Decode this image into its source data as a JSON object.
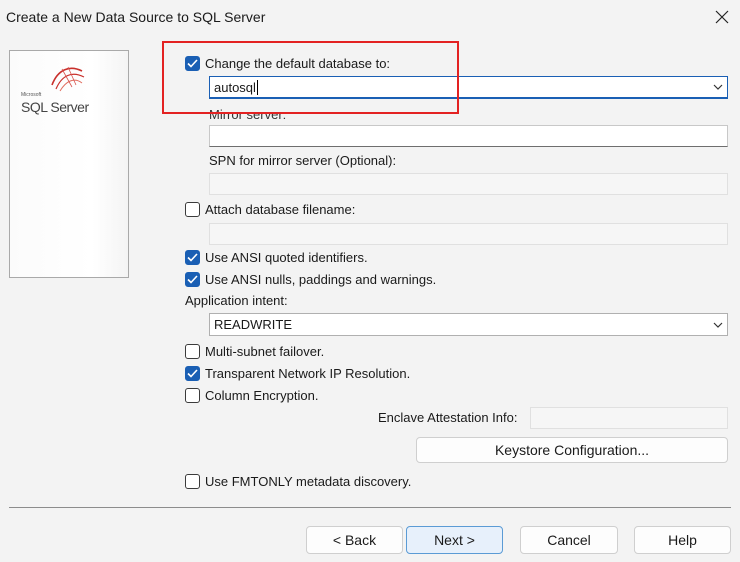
{
  "window": {
    "title": "Create a New Data Source to SQL Server"
  },
  "logo": {
    "small_text": "Microsoft",
    "text": "SQL Server"
  },
  "options": {
    "change_default_db": {
      "label": "Change the default database to:",
      "checked": true
    },
    "database_value": "autosql",
    "mirror_server_label": "Mirror server:",
    "spn_label": "SPN for mirror server (Optional):",
    "attach_db": {
      "label": "Attach database filename:",
      "checked": false
    },
    "ansi_quoted": {
      "label": "Use ANSI quoted identifiers.",
      "checked": true
    },
    "ansi_nulls": {
      "label": "Use ANSI nulls, paddings and warnings.",
      "checked": true
    },
    "app_intent_label": "Application intent:",
    "app_intent_value": "READWRITE",
    "multi_subnet": {
      "label": "Multi-subnet failover.",
      "checked": false
    },
    "transparent_ip": {
      "label": "Transparent Network IP Resolution.",
      "checked": true
    },
    "column_encryption": {
      "label": "Column Encryption.",
      "checked": false
    },
    "enclave_label": "Enclave Attestation Info:",
    "keystore_button": "Keystore Configuration...",
    "fmtonly": {
      "label": "Use FMTONLY metadata discovery.",
      "checked": false
    }
  },
  "footer": {
    "back": "< Back",
    "next": "Next >",
    "cancel": "Cancel",
    "help": "Help"
  },
  "colors": {
    "accent": "#1a5fb4",
    "highlight": "#e32222",
    "background": "#f3f3f3"
  },
  "icons": {
    "close": "close-icon",
    "dropdown": "chevron-down-icon",
    "check": "checkmark-icon"
  }
}
